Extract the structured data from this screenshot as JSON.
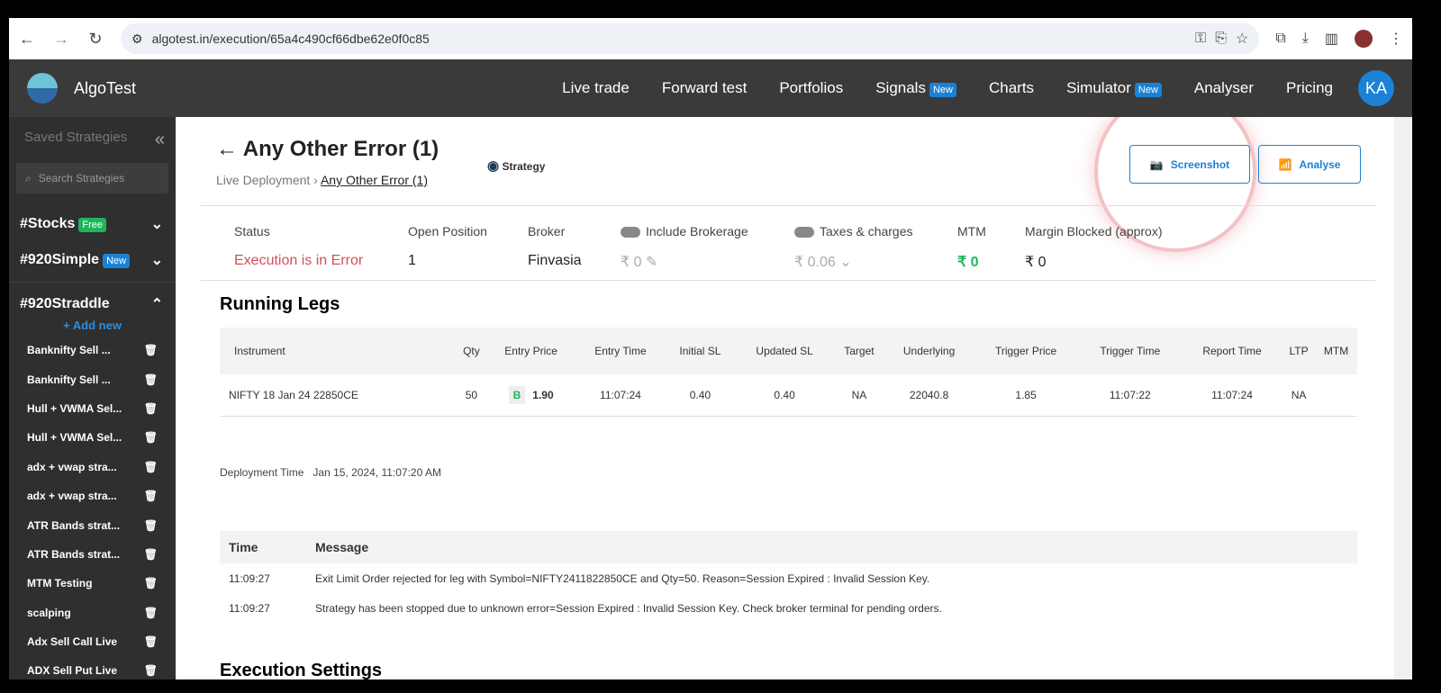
{
  "browser": {
    "url": "algotest.in/execution/65a4c490cf66dbe62e0f0c85"
  },
  "nav": {
    "brand": "AlgoTest",
    "links": [
      "Live trade",
      "Forward test",
      "Portfolios",
      "Signals",
      "Charts",
      "Simulator",
      "Analyser",
      "Pricing"
    ],
    "new_badge": "New",
    "avatar": "KA"
  },
  "sidebar": {
    "title": "Saved Strategies",
    "search_placeholder": "Search Strategies",
    "groups": [
      {
        "name": "#Stocks",
        "badge": "Free"
      },
      {
        "name": "#920Simple",
        "badge": "New"
      },
      {
        "name": "#920Straddle",
        "badge": ""
      }
    ],
    "add_new": "+ Add new",
    "items": [
      "Banknifty Sell ...",
      "Banknifty Sell ...",
      "Hull + VWMA Sel...",
      "Hull + VWMA Sel...",
      "adx + vwap stra...",
      "adx + vwap stra...",
      "ATR Bands strat...",
      "ATR Bands strat...",
      "MTM Testing",
      "scalping",
      "Adx Sell Call Live",
      "ADX Sell Put Live"
    ]
  },
  "page": {
    "title": "Any Other Error (1)",
    "breadcrumb_root": "Live Deployment",
    "breadcrumb_current": "Any Other Error (1)",
    "strategy_label": "Strategy",
    "screenshot": "Screenshot",
    "analyse": "Analyse"
  },
  "summary": {
    "status_label": "Status",
    "status": "Execution is in Error",
    "open_label": "Open Position",
    "open": "1",
    "broker_label": "Broker",
    "broker": "Finvasia",
    "brokerage_label": "Include Brokerage",
    "brokerage": "₹ 0",
    "taxes_label": "Taxes & charges",
    "taxes": "₹ 0.06",
    "mtm_label": "MTM",
    "mtm": "₹ 0",
    "margin_label": "Margin Blocked (approx)",
    "margin": "₹ 0"
  },
  "legs": {
    "title": "Running Legs",
    "headers": [
      "Instrument",
      "Qty",
      "Entry Price",
      "Entry Time",
      "Initial SL",
      "Updated SL",
      "Target",
      "Underlying",
      "Trigger Price",
      "Trigger Time",
      "Report Time",
      "LTP",
      "MTM"
    ],
    "rows": [
      {
        "instrument": "NIFTY 18 Jan 24 22850CE",
        "qty": "50",
        "side": "B",
        "entry_price": "1.90",
        "entry_time": "11:07:24",
        "initial_sl": "0.40",
        "updated_sl": "0.40",
        "target": "NA",
        "underlying": "22040.8",
        "trigger_price": "1.85",
        "trigger_time": "11:07:22",
        "report_time": "11:07:24",
        "ltp": "NA",
        "mtm": ""
      }
    ]
  },
  "deployment": {
    "label": "Deployment Time",
    "value": "Jan 15, 2024, 11:07:20 AM"
  },
  "logs": {
    "headers": [
      "Time",
      "Message"
    ],
    "rows": [
      {
        "time": "11:09:27",
        "message": "Exit Limit Order rejected for leg with Symbol=NIFTY2411822850CE and Qty=50. Reason=Session Expired : Invalid Session Key."
      },
      {
        "time": "11:09:27",
        "message": "Strategy has been stopped due to unknown error=Session Expired : Invalid Session Key. Check broker terminal for pending orders."
      }
    ]
  },
  "settings_title": "Execution Settings"
}
